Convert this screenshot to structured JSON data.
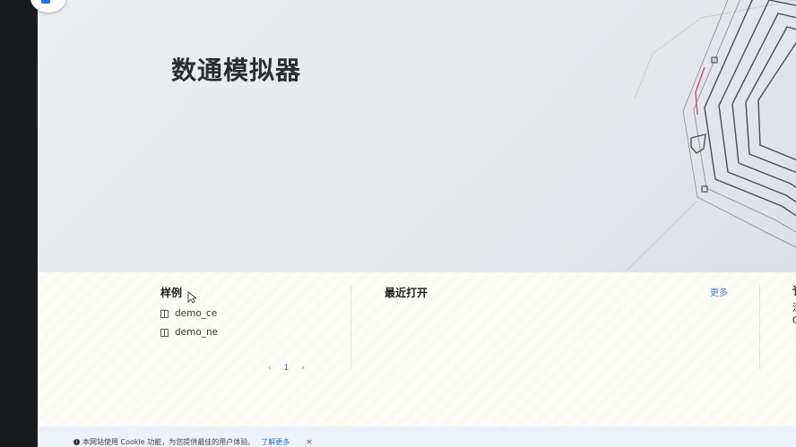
{
  "hero": {
    "title": "数通模拟器"
  },
  "samples": {
    "title": "样例",
    "items": [
      {
        "label": "demo_ce",
        "icon": "book-icon"
      },
      {
        "label": "demo_ne",
        "icon": "book-icon"
      }
    ],
    "pager": {
      "prev": "‹",
      "page": "1",
      "next": "›"
    }
  },
  "recent": {
    "title": "最近打开",
    "more_label": "更多"
  },
  "third_panel": {
    "title_fragment": "讠",
    "line1": "涂",
    "line2": "C"
  },
  "cookie": {
    "info_icon": "info-icon",
    "text": "本网站使用 Cookie 功能，为您提供最佳的用户体验。",
    "link": "了解更多",
    "close": "×"
  },
  "colors": {
    "accent": "#2a6dd9",
    "hero_bg": "#e6e9ec",
    "sidebar": "#1a1b1e",
    "cookie_bg": "#edf1f8"
  }
}
